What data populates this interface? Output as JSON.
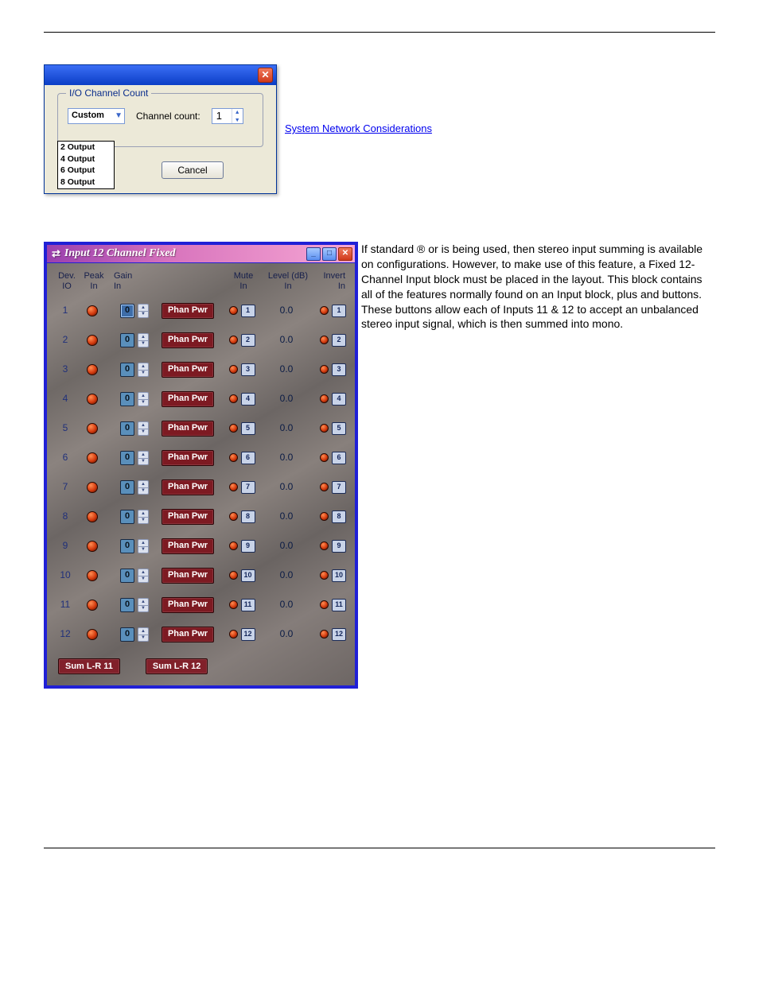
{
  "dlg1": {
    "group_legend": "I/O Channel Count",
    "combo_value": "Custom",
    "combo_options": [
      "2 Output",
      "4 Output",
      "6 Output",
      "8 Output"
    ],
    "channel_count_label": "Channel count:",
    "channel_count_value": "1",
    "cancel": "Cancel"
  },
  "side_link": "System Network Considerations",
  "dlg2": {
    "title": "Input 12 Channel Fixed",
    "headers": {
      "dev": "Dev.\nIO",
      "peak": "Peak\nIn",
      "gain": "Gain\nIn",
      "mute": "Mute\nIn",
      "level": "Level (dB)\nIn",
      "invert": "Invert\nIn"
    },
    "phan_label": "Phan Pwr",
    "level_value": "0.0",
    "gain_value": "0",
    "channels": [
      1,
      2,
      3,
      4,
      5,
      6,
      7,
      8,
      9,
      10,
      11,
      12
    ],
    "sum11": "Sum L-R 11",
    "sum12": "Sum L-R 12"
  },
  "para": {
    "t1": "If standard ",
    "t2": "® or ",
    "t3": " is being used, then stereo input summing is available on ",
    "t4": " configurations. However, to make use of this feature, a Fixed 12-Channel Input block must be placed in the layout. This block contains all of the features normally found on an Input block, plus ",
    "t5": " and ",
    "t6": " buttons. These buttons allow each of Inputs 11 & 12 to accept an unbalanced stereo input signal, which is then summed into mono."
  }
}
